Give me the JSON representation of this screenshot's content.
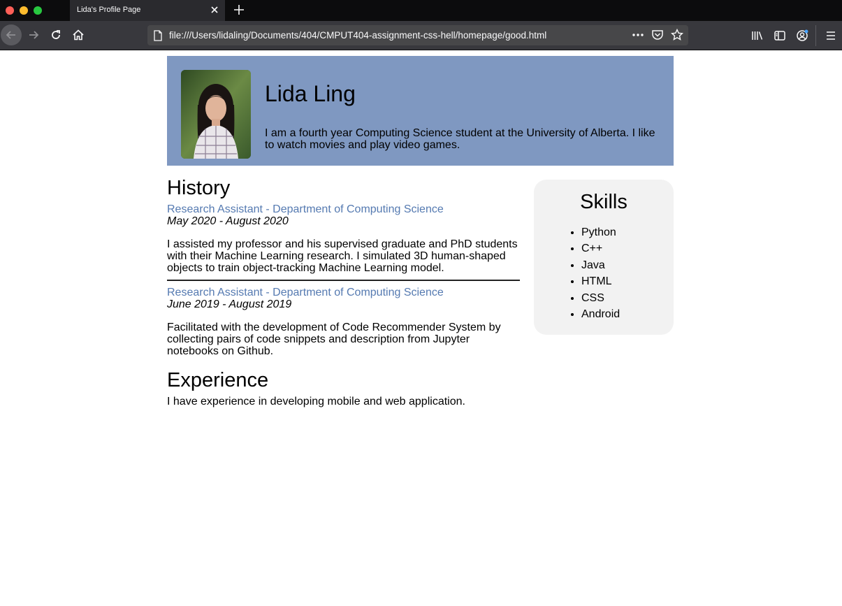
{
  "browser": {
    "tab_title": "Lida's Profile Page",
    "url": "file:///Users/lidaling/Documents/404/CMPUT404-assignment-css-hell/homepage/good.html",
    "url_more": "•••"
  },
  "profile": {
    "name": "Lida Ling",
    "bio": "I am a fourth year Computing Science student at the University of Alberta. I like to watch movies and play video games."
  },
  "history": {
    "title": "History",
    "jobs": [
      {
        "title": "Research Assistant - Department of Computing Science",
        "date": "May 2020 - August 2020",
        "description": "I assisted my professor and his supervised graduate and PhD students with their Machine Learning research. I simulated 3D human-shaped objects to train object-tracking Machine Learning model."
      },
      {
        "title": "Research Assistant - Department of Computing Science",
        "date": "June 2019 - August 2019",
        "description": "Facilitated with the development of Code Recommender System by collecting pairs of code snippets and description from Jupyter notebooks on Github."
      }
    ]
  },
  "experience": {
    "title": "Experience",
    "text": "I have experience in developing mobile and web application."
  },
  "skills": {
    "title": "Skills",
    "items": [
      "Python",
      "C++",
      "Java",
      "HTML",
      "CSS",
      "Android"
    ]
  },
  "colors": {
    "header_bg": "#7f98c1",
    "link_blue": "#557ab1",
    "skills_bg": "#f2f2f2"
  }
}
